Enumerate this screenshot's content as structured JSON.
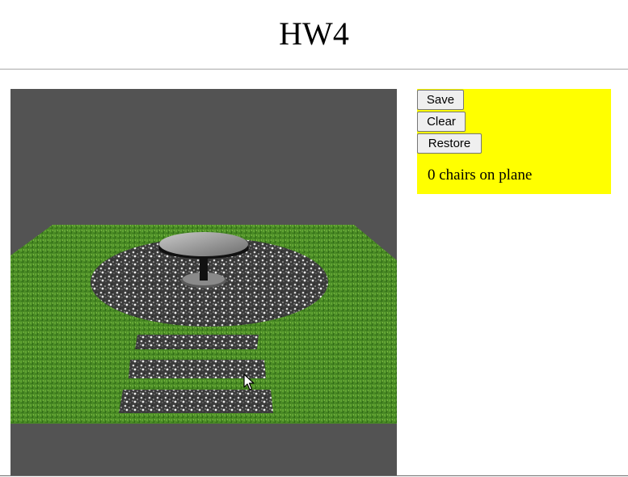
{
  "title": "HW4",
  "controls": {
    "save_label": "Save",
    "clear_label": "Clear",
    "restore_label": "Restore"
  },
  "status": {
    "text": "0 chairs on plane"
  },
  "colors": {
    "panel_background": "#ffff00",
    "scene_background": "#535353",
    "grass": "#4a8a25"
  },
  "icons": {
    "cursor": "mouse-pointer-icon"
  }
}
